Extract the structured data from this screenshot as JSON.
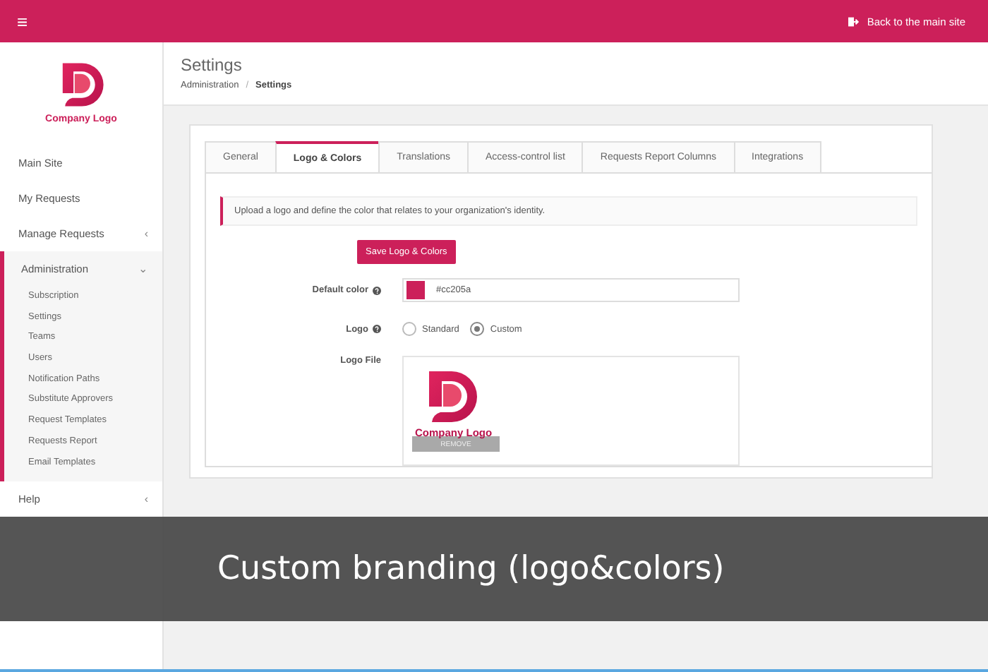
{
  "topbar": {
    "menu_glyph": "≡",
    "back_link": "Back to the main site"
  },
  "sidebar": {
    "logo_text": "Company Logo",
    "items": [
      {
        "label": "Main Site",
        "kind": "link",
        "selected": false
      },
      {
        "label": "My Requests",
        "kind": "link",
        "selected": false
      },
      {
        "label": "Manage Requests",
        "kind": "group",
        "selected": false,
        "expanded": false,
        "caret": "‹"
      },
      {
        "label": "Administration",
        "kind": "group",
        "selected": true,
        "expanded": true,
        "caret": "⌄",
        "children": [
          "Subscription",
          "Settings",
          "Teams",
          "Users",
          "Notification Paths",
          "Substitute Approvers",
          "Request Templates",
          "Requests Report",
          "Email Templates"
        ]
      },
      {
        "label": "Help",
        "kind": "group",
        "selected": false,
        "expanded": false,
        "caret": "‹"
      }
    ]
  },
  "page": {
    "title": "Settings",
    "breadcrumb": [
      "Administration",
      "Settings"
    ],
    "breadcrumb_separator": "/"
  },
  "tabs": [
    {
      "label": "General",
      "selected": false
    },
    {
      "label": "Logo & Colors",
      "selected": true
    },
    {
      "label": "Translations",
      "selected": false
    },
    {
      "label": "Access-control list",
      "selected": false
    },
    {
      "label": "Requests Report Columns",
      "selected": false
    },
    {
      "label": "Integrations",
      "selected": false
    }
  ],
  "info": "Upload a logo and define the color that relates to your organization's identity.",
  "save_button": "Save Logo & Colors",
  "form": {
    "default_color": {
      "label": "Default color",
      "color": "#cc205a",
      "value": "#cc205a"
    },
    "logo": {
      "label": "Logo",
      "options": [
        {
          "label": "Standard",
          "selected": false
        },
        {
          "label": "Custom",
          "selected": true
        }
      ]
    },
    "logo_file": {
      "label": "Logo File",
      "logo_text": "Company Logo",
      "remove": "REMOVE"
    }
  },
  "caption": "Custom branding (logo&colors)"
}
